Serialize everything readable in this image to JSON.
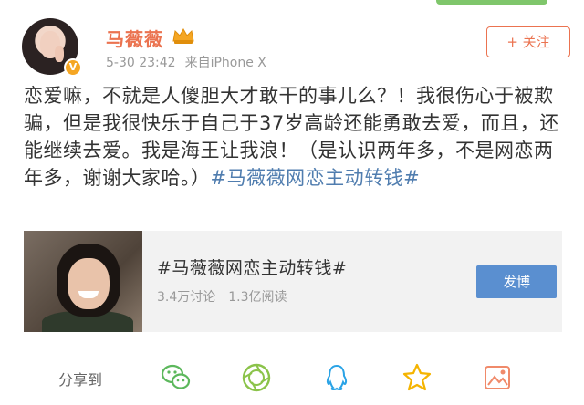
{
  "post": {
    "username": "马薇薇",
    "timestamp": "5-30 23:42",
    "source": "来自iPhone X",
    "follow_label": "+ 关注",
    "text_main": "恋爱嘛，不就是人傻胆大才敢干的事儿么？！我很伤心于被欺骗，但是我很快乐于自己于37岁高龄还能勇敢去爱，而且，还能继续去爱。我是海王让我浪！（是认识两年多，不是网恋两年多，谢谢大家哈。）",
    "hashtag": "#马薇薇网恋主动转钱#"
  },
  "topic_card": {
    "title": "#马薇薇网恋主动转钱#",
    "discussions": "3.4万讨论",
    "reads": "1.3亿阅读",
    "post_label": "发博"
  },
  "share": {
    "label": "分享到",
    "icons": [
      "wechat-icon",
      "moments-icon",
      "qq-icon",
      "qzone-icon",
      "album-icon"
    ]
  },
  "colors": {
    "username": "#eb7350",
    "hashtag": "#507daf",
    "post_button": "#5a8fd0"
  }
}
